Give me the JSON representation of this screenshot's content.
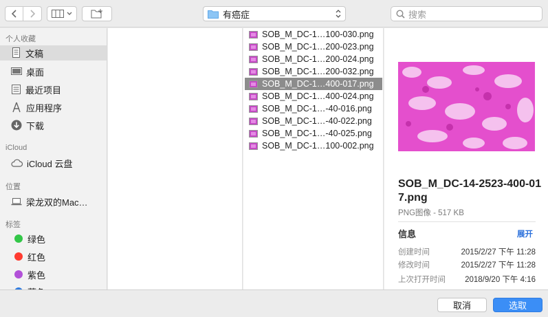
{
  "toolbar": {
    "path_label": "有癌症",
    "search_placeholder": "搜索"
  },
  "sidebar": {
    "favorites_title": "个人收藏",
    "favorites": [
      {
        "label": "文稿",
        "icon": "document-icon"
      },
      {
        "label": "桌面",
        "icon": "desktop-icon"
      },
      {
        "label": "最近项目",
        "icon": "recents-icon"
      },
      {
        "label": "应用程序",
        "icon": "applications-icon"
      },
      {
        "label": "下载",
        "icon": "download-icon"
      }
    ],
    "icloud_title": "iCloud",
    "icloud_items": [
      {
        "label": "iCloud 云盘",
        "icon": "cloud-icon"
      }
    ],
    "locations_title": "位置",
    "locations": [
      {
        "label": "梁龙双的Mac…",
        "icon": "laptop-icon"
      }
    ],
    "tags_title": "标签",
    "tags": [
      {
        "label": "绿色",
        "color": "#33c748"
      },
      {
        "label": "红色",
        "color": "#ff3b30"
      },
      {
        "label": "紫色",
        "color": "#b251d8"
      },
      {
        "label": "蓝色",
        "color": "#2f7be0"
      }
    ]
  },
  "files": [
    {
      "name": "SOB_M_DC-1…100-030.png"
    },
    {
      "name": "SOB_M_DC-1…200-023.png"
    },
    {
      "name": "SOB_M_DC-1…200-024.png"
    },
    {
      "name": "SOB_M_DC-1…200-032.png"
    },
    {
      "name": "SOB_M_DC-1…400-017.png",
      "selected": true
    },
    {
      "name": "SOB_M_DC-1…400-024.png"
    },
    {
      "name": "SOB_M_DC-1…-40-016.png"
    },
    {
      "name": "SOB_M_DC-1…-40-022.png"
    },
    {
      "name": "SOB_M_DC-1…-40-025.png"
    },
    {
      "name": "SOB_M_DC-1…100-002.png"
    }
  ],
  "preview": {
    "file_name": "SOB_M_DC-14-2523-400-017.png",
    "kind": "PNG图像 - 517 KB",
    "info_title": "信息",
    "expand_label": "展开",
    "meta": [
      {
        "key": "创建时间",
        "value": "2015/2/27 下午 11:28"
      },
      {
        "key": "修改时间",
        "value": "2015/2/27 下午 11:28"
      },
      {
        "key": "上次打开时间",
        "value": "2018/9/20 下午 4:16"
      }
    ]
  },
  "buttons": {
    "cancel": "取消",
    "choose": "选取"
  }
}
